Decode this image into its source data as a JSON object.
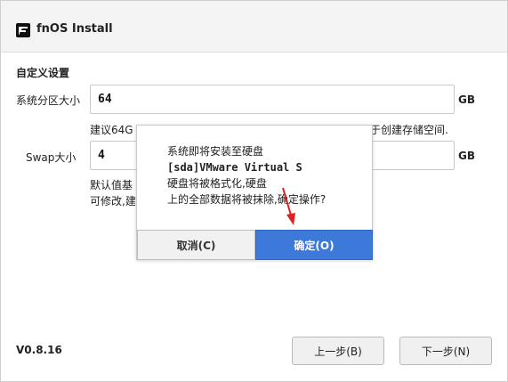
{
  "window": {
    "title": "fnOS Install",
    "icon": "fnos-logo-icon"
  },
  "section": {
    "title": "自定义设置"
  },
  "system_partition": {
    "label": "系统分区大小",
    "value": "64",
    "unit": "GB",
    "hint_left": "建议64G",
    "hint_right": "于创建存储空间."
  },
  "swap": {
    "label": "Swap大小",
    "value": "4",
    "unit": "GB",
    "hint_line1": "默认值基",
    "hint_line2": "可修改,建"
  },
  "footer": {
    "version": "V0.8.16",
    "prev_label": "上一步(B)",
    "next_label": "下一步(N)"
  },
  "dialog": {
    "line1": "系统即将安装至硬盘",
    "line2": "[sda]VMware Virtual S",
    "line3": "硬盘将被格式化,硬盘",
    "line4": "上的全部数据将被抹除,确定操作?",
    "cancel_label": "取消(C)",
    "ok_label": "确定(O)"
  },
  "colors": {
    "primary": "#3c79d9",
    "arrow": "#e02020"
  }
}
